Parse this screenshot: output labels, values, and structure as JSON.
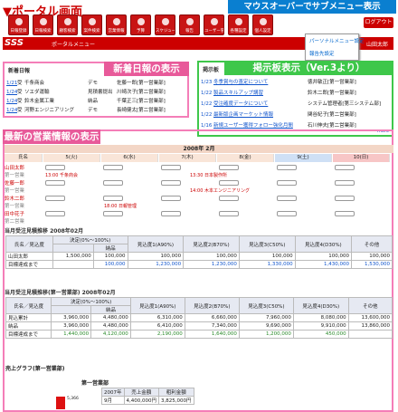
{
  "header": {
    "page_title": "▼ポータル画面",
    "callout_submenu": "マウスオーバーでサブメニュー表示",
    "logout": "ログアウト",
    "logo": "SSS",
    "breadcrumb": "ポータルメニュー",
    "user": "山田太郎"
  },
  "toolbar": {
    "items": [
      "日報登録",
      "日報検索",
      "顧客検索",
      "案件検索",
      "営業情報",
      "予算",
      "スケジュール",
      "報告",
      "ユーザー管理",
      "各種設定",
      "個人設定"
    ]
  },
  "submenu": {
    "items": [
      "パーソナルメニュー設定",
      "報告先設定"
    ]
  },
  "news": {
    "heading": "新着日報",
    "callout": "新着日報の表示",
    "rows": [
      {
        "date": "1/21",
        "kind": "受",
        "company": "千条商会",
        "type": "デモ",
        "by": "佐藤一郎[第一営業部]"
      },
      {
        "date": "1/24",
        "kind": "受",
        "company": "ソエダ運輸",
        "type": "見積書提出",
        "by": "川崎次子[第二営業部]"
      },
      {
        "date": "1/24",
        "kind": "受",
        "company": "鈴木金属工業",
        "type": "納品",
        "by": "千葉正三[第二営業部]"
      },
      {
        "date": "1/24",
        "kind": "受",
        "company": "河野エンジニアリング",
        "type": "デモ",
        "by": "長崎健太[第二営業部]"
      }
    ]
  },
  "board": {
    "heading": "掲示板",
    "callout": "掲示板表示（Ver.3より）",
    "rows": [
      {
        "date": "1/23",
        "title": "冬季賞与の査定について",
        "by": "徳井敏正[第一営業部]"
      },
      {
        "date": "1/22",
        "title": "製品スキルアップ講習",
        "by": "鈴木二郎[第一営業部]"
      },
      {
        "date": "1/22",
        "title": "受注確度データについて",
        "by": "システム管理者[第三システム部]"
      },
      {
        "date": "1/22",
        "title": "最新版企画マーケット情報",
        "by": "関谷紀子[第二営業部]"
      },
      {
        "date": "1/16",
        "title": "新規ユーザー獲得フォロー強化月間",
        "by": "石川伸夫[第二営業部]"
      }
    ],
    "more": "more"
  },
  "sales": {
    "callout": "最新の営業情報の表示",
    "calendar_title": "2008年 2月",
    "days": [
      "5(火)",
      "6(水)",
      "7(木)",
      "8(金)",
      "9(土)",
      "10(日)"
    ],
    "name_header": "氏名",
    "people": [
      {
        "name": "山田太郎",
        "dept": "第一営業"
      },
      {
        "name": "佐藤一郎",
        "dept": "第一営業"
      },
      {
        "name": "鈴木二郎",
        "dept": "第一営業"
      },
      {
        "name": "田中花子",
        "dept": "第二営業"
      }
    ],
    "events": [
      "13:00 千条商会",
      "13:30 日本製作所",
      "14:00 木本エンジニアリング",
      "18:00 日報管理"
    ]
  },
  "budget": {
    "title": "当月受注見積推移 2008年02月",
    "cols": [
      "決定(0%〜100%)",
      "見込度1(A90%)",
      "見込度2(B70%)",
      "見込度3(C50%)",
      "見込度4(D30%)",
      "その他"
    ],
    "sub_col": "納品",
    "rows": [
      {
        "label": "山田太郎",
        "vals": [
          "1,500,000",
          "100,000",
          "100,000",
          "100,000",
          "100,000",
          "100,000",
          "100,000"
        ]
      },
      {
        "label": "目標達成まで",
        "vals": [
          "",
          "100,000",
          "1,230,000",
          "1,230,000",
          "1,330,000",
          "1,430,000",
          "1,530,000"
        ]
      }
    ]
  },
  "budget_dept": {
    "title": "当月受注見積推移(第一営業部) 2008年02月",
    "row_label": "氏名／見込度",
    "rows": [
      {
        "label": "見込累計",
        "vals": [
          "3,960,000",
          "4,480,000",
          "6,310,000",
          "6,660,000",
          "7,960,000",
          "8,080,000",
          "13,600,000"
        ]
      },
      {
        "label": "納品",
        "vals": [
          "3,960,000",
          "4,480,000",
          "6,410,000",
          "7,340,000",
          "9,690,000",
          "9,910,000",
          "13,860,000"
        ]
      },
      {
        "label": "目標達成まで",
        "vals": [
          "1,440,000",
          "4,120,000",
          "2,190,000",
          "1,640,000",
          "1,200,000",
          "450,000",
          ""
        ]
      }
    ]
  },
  "graph": {
    "title": "売上グラフ(第一営業部)",
    "subtitle": "第一営業部",
    "table_head": [
      "2007年",
      "売上金額",
      "粗利金額"
    ],
    "table_rows": [
      [
        "9月",
        "4,400,000円",
        "3,825,000円"
      ]
    ],
    "bar_label": "5,366"
  },
  "colors": {
    "red": "#c00",
    "pink": "#f47eb8",
    "green": "#3ec74a",
    "blue": "#0a7fd0"
  }
}
